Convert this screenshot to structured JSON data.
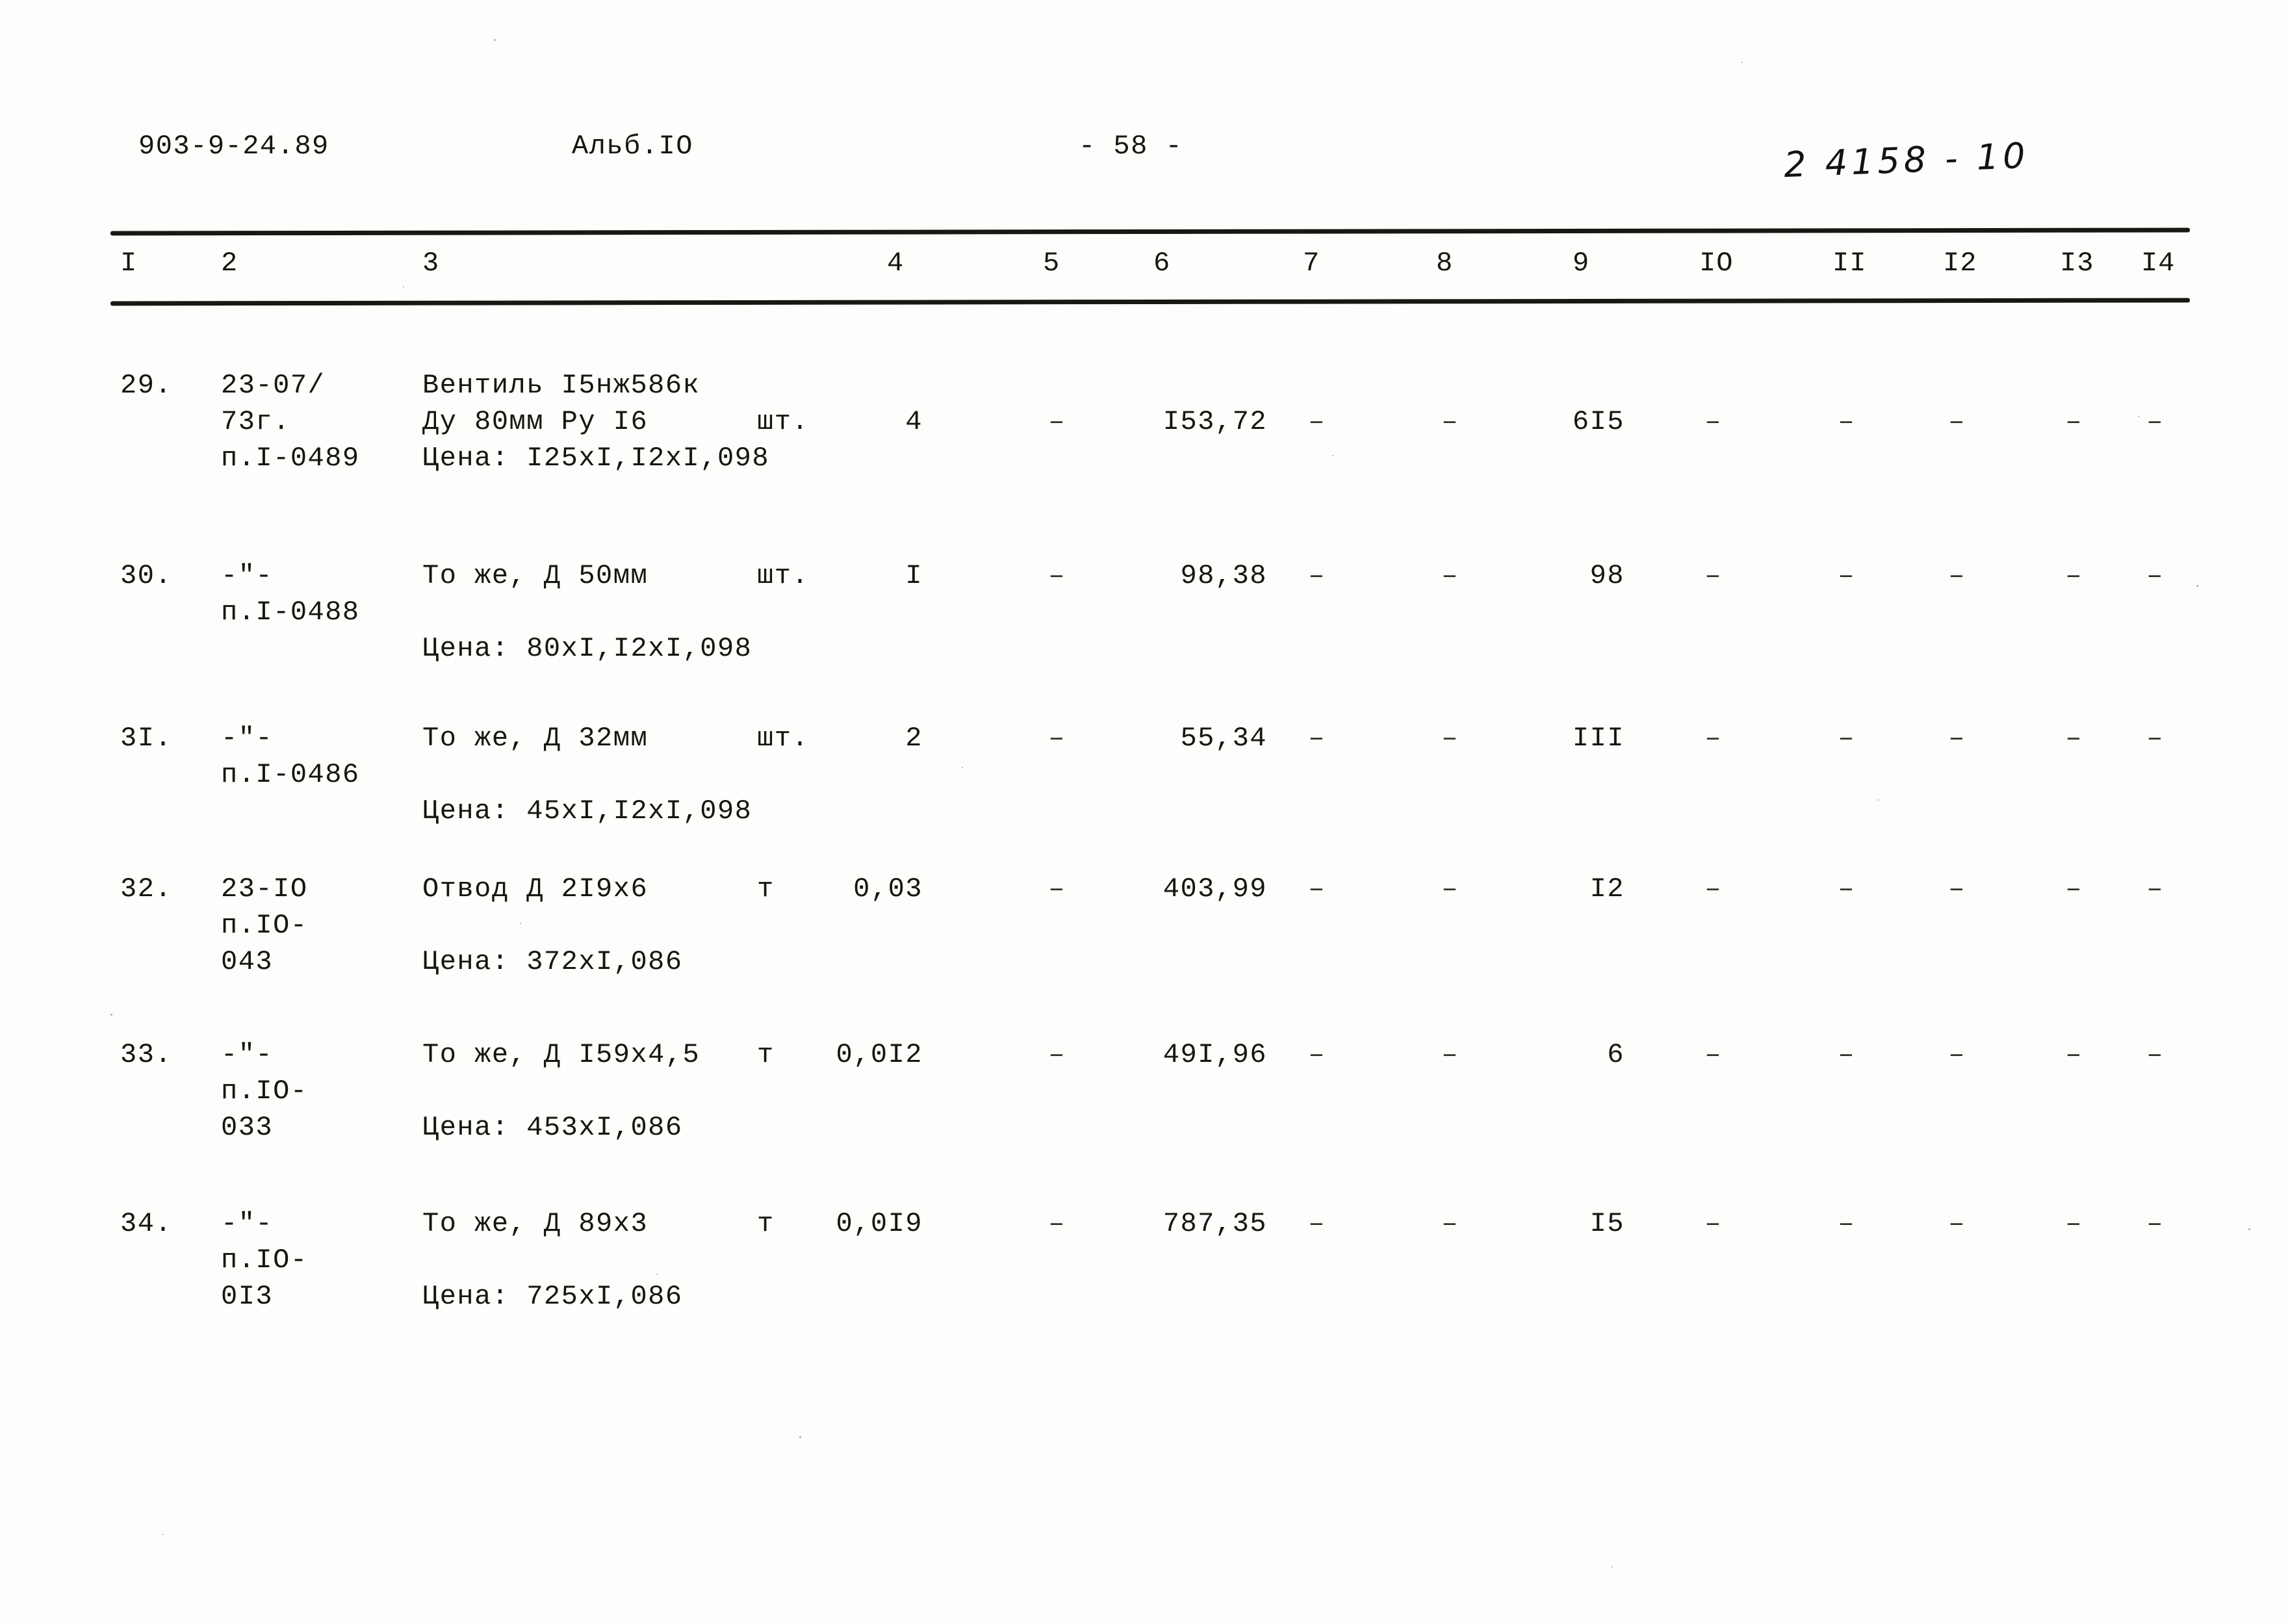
{
  "header": {
    "doc_code": "903-9-24.89",
    "album": "Альб.IO",
    "page_number": "- 58 -",
    "handwritten_note": "2 4158 - 10"
  },
  "table": {
    "column_headers": [
      "I",
      "2",
      "3",
      "4",
      "5",
      "6",
      "7",
      "8",
      "9",
      "IO",
      "II",
      "I2",
      "I3",
      "I4"
    ],
    "rows": [
      {
        "no": "29.",
        "code_lines": [
          "23-07/",
          "73г.",
          "п.I-0489"
        ],
        "name_lines": [
          "Вентиль I5нж586к",
          "Ду 80мм Ру I6"
        ],
        "price_line": "Цена: I25xI,I2xI,098",
        "unit": "шт.",
        "c4": "4",
        "c5": "–",
        "c6": "I53,72",
        "c7": "–",
        "c8": "–",
        "c9": "6I5",
        "c10": "–",
        "c11": "–",
        "c12": "–",
        "c13": "–",
        "c14": "–"
      },
      {
        "no": "30.",
        "code_lines": [
          "-\"-",
          "п.I-0488"
        ],
        "name_lines": [
          "То же, Д 50мм"
        ],
        "price_line": "Цена: 80xI,I2xI,098",
        "unit": "шт.",
        "c4": "I",
        "c5": "–",
        "c6": "98,38",
        "c7": "–",
        "c8": "–",
        "c9": "98",
        "c10": "–",
        "c11": "–",
        "c12": "–",
        "c13": "–",
        "c14": "–"
      },
      {
        "no": "3I.",
        "code_lines": [
          "-\"-",
          "п.I-0486"
        ],
        "name_lines": [
          "То же, Д 32мм"
        ],
        "price_line": "Цена: 45xI,I2xI,098",
        "unit": "шт.",
        "c4": "2",
        "c5": "–",
        "c6": "55,34",
        "c7": "–",
        "c8": "–",
        "c9": "III",
        "c10": "–",
        "c11": "–",
        "c12": "–",
        "c13": "–",
        "c14": "–"
      },
      {
        "no": "32.",
        "code_lines": [
          "23-IO",
          "п.IO-",
          "043"
        ],
        "name_lines": [
          "Отвод Д 2I9x6"
        ],
        "price_line": "Цена: 372xI,086",
        "unit": "т",
        "c4": "0,03",
        "c5": "–",
        "c6": "403,99",
        "c7": "–",
        "c8": "–",
        "c9": "I2",
        "c10": "–",
        "c11": "–",
        "c12": "–",
        "c13": "–",
        "c14": "–"
      },
      {
        "no": "33.",
        "code_lines": [
          "-\"-",
          "п.IO-",
          "033"
        ],
        "name_lines": [
          "То же, Д I59x4,5"
        ],
        "price_line": "Цена: 453xI,086",
        "unit": "т",
        "c4": "0,0I2",
        "c5": "–",
        "c6": "49I,96",
        "c7": "–",
        "c8": "–",
        "c9": "6",
        "c10": "–",
        "c11": "–",
        "c12": "–",
        "c13": "–",
        "c14": "–"
      },
      {
        "no": "34.",
        "code_lines": [
          "-\"-",
          "п.IO-",
          "0I3"
        ],
        "name_lines": [
          "То же, Д 89x3"
        ],
        "price_line": "Цена: 725xI,086",
        "unit": "т",
        "c4": "0,0I9",
        "c5": "–",
        "c6": "787,35",
        "c7": "–",
        "c8": "–",
        "c9": "I5",
        "c10": "–",
        "c11": "–",
        "c12": "–",
        "c13": "–",
        "c14": "–"
      }
    ]
  }
}
